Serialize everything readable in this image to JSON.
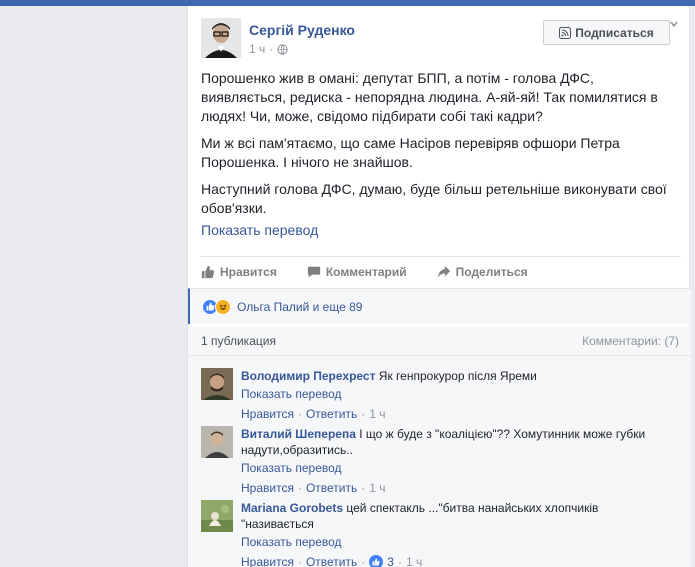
{
  "post": {
    "author": "Сергій Руденко",
    "time": "1 ч",
    "subscribe_label": "Подписаться",
    "paragraphs": [
      "Порошенко жив в омані: депутат БПП, а потім - голова ДФС, виявляється, редиска - непорядна людина. А-яй-яй! Так помилятися в людях! Чи, може, свідомо підбирати собі такі кадри?",
      "Ми ж всі пам'ятаємо, що саме Насіров перевіряв офшори Петра Порошенка. І нічого не знайшов.",
      "Наступний голова ДФС, думаю, буде більш ретельніше виконувати свої обов'язки."
    ],
    "translate_label": "Показать перевод"
  },
  "actions": {
    "like": "Нравится",
    "comment": "Комментарий",
    "share": "Поделиться"
  },
  "reactions": {
    "summary": "Ольга Палий и еще 89"
  },
  "comments_header": {
    "shares": "1 публикация",
    "count": "Комментарии: (7)"
  },
  "comments": [
    {
      "name": "Володимир Перехрест",
      "text": " Як генпрокурор після Яреми",
      "translate": "Показать перевод",
      "like": "Нравится",
      "sep1": "·",
      "reply": "Ответить",
      "sep2": "·",
      "time": "1 ч"
    },
    {
      "name": "Виталий Шеперепа",
      "text": " І що ж буде з \"коаліцією\"?? Хомутинник може губки надути,образитись..",
      "translate": "Показать перевод",
      "like": "Нравится",
      "sep1": "·",
      "reply": "Ответить",
      "sep2": "·",
      "time": "1 ч"
    },
    {
      "name": "Mariana Gorobets",
      "text": " цей спектакль ...\"битва нанайських хлопчиків \"називається",
      "translate": "Показать перевод",
      "like": "Нравится",
      "sep1": "·",
      "reply": "Ответить",
      "sep2": "·",
      "likes": "3",
      "sep3": "·",
      "time": "1 ч"
    }
  ],
  "colors": {
    "link": "#365899",
    "fb_blue": "#4267b2",
    "like_blue": "#4080ff"
  }
}
